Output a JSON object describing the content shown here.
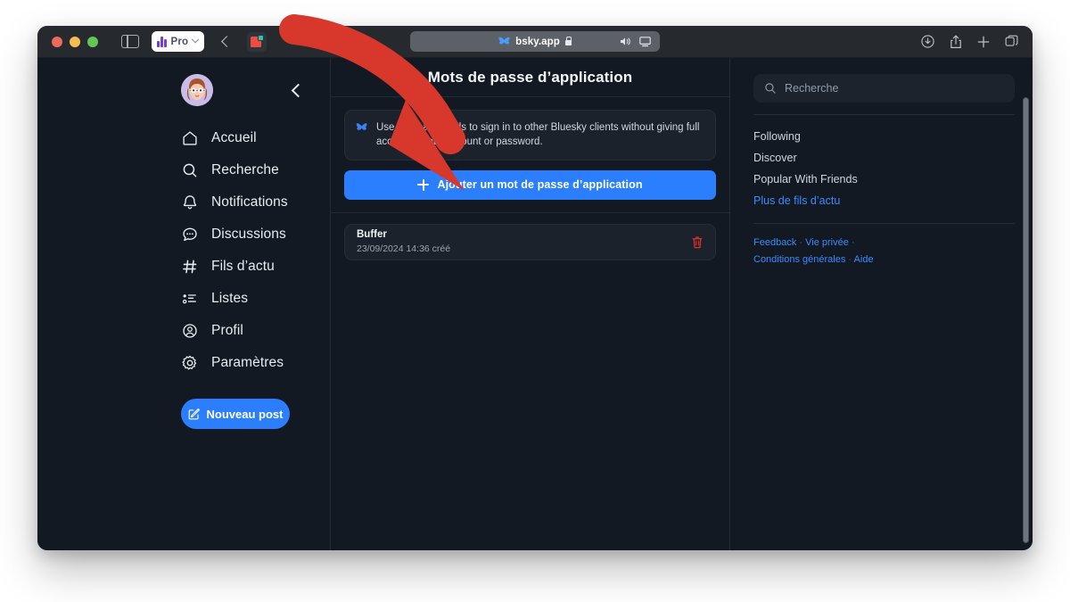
{
  "browser": {
    "traffic_lights": [
      "close",
      "minimize",
      "zoom"
    ],
    "sidebar_toggle_icon": "sidebar-icon",
    "pro_badge": {
      "label": "Pro",
      "icon": "bar-chart-icon",
      "chevron": "chevron-down-icon"
    },
    "back_icon": "chevron-left-icon",
    "app_icon": "app-logo-icon",
    "url": "bsky.app",
    "url_site_icon": "butterfly-icon",
    "lock_icon": "lock-icon",
    "url_right_icons": [
      "speaker-icon",
      "screen-share-icon"
    ],
    "toolbar_right_icons": [
      "download-icon",
      "share-icon",
      "new-tab-icon",
      "tabs-icon"
    ]
  },
  "sidebar": {
    "avatar": "user-avatar",
    "collapse_icon": "chevron-left-icon",
    "items": [
      {
        "label": "Accueil",
        "icon": "home-icon"
      },
      {
        "label": "Recherche",
        "icon": "search-icon"
      },
      {
        "label": "Notifications",
        "icon": "bell-icon"
      },
      {
        "label": "Discussions",
        "icon": "chat-icon"
      },
      {
        "label": "Fils d’actu",
        "icon": "hash-icon"
      },
      {
        "label": "Listes",
        "icon": "list-icon"
      },
      {
        "label": "Profil",
        "icon": "person-circle-icon"
      },
      {
        "label": "Paramètres",
        "icon": "gear-icon"
      }
    ],
    "new_post": {
      "label": "Nouveau post",
      "icon": "compose-icon"
    }
  },
  "main": {
    "title": "Mots de passe d’application",
    "info": {
      "icon": "butterfly-icon",
      "text": "Use app passwords to sign in to other Bluesky clients without giving full access to your account or password."
    },
    "add_button": {
      "label": "Ajouter un mot de passe d’application",
      "icon": "plus-icon"
    },
    "passwords": [
      {
        "name": "Buffer",
        "created": "23/09/2024 14:36 créé",
        "delete_icon": "trash-icon"
      }
    ]
  },
  "right": {
    "search": {
      "placeholder": "Recherche",
      "icon": "search-icon"
    },
    "feeds": [
      "Following",
      "Discover",
      "Popular With Friends"
    ],
    "more_feeds_link": "Plus de fils d’actu",
    "footer_links": [
      "Feedback",
      "Vie privée",
      "Conditions générales",
      "Aide"
    ],
    "footer_separator": "·"
  },
  "annotation": {
    "shape": "curved-down-right-arrow",
    "color": "#d8382b",
    "points_to": "add-app-password-button"
  },
  "colors": {
    "app_background": "#131922",
    "card_background": "#1b222c",
    "accent_blue": "#2b7fff",
    "link_blue": "#3d8bfd",
    "danger_red": "#e0342c",
    "titlebar": "#262a2e"
  }
}
